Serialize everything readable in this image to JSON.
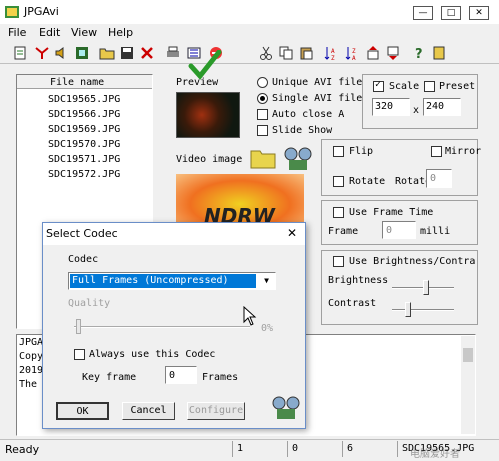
{
  "window": {
    "title": "JPGAvi"
  },
  "menu": [
    "File",
    "Edit",
    "View",
    "Help"
  ],
  "toolbar": {
    "icons": [
      "new-icon",
      "cut-marker-icon",
      "speaker-icon",
      "film-icon",
      "open-folder-icon",
      "save-icon",
      "delete-icon",
      "print-icon",
      "add-frame-icon",
      "no-icon",
      "scissors-icon",
      "copy-icon",
      "paste-icon",
      "sort-asc-icon",
      "sort-desc-icon",
      "move-up-icon",
      "move-down-icon",
      "help-icon",
      "about-icon"
    ]
  },
  "filelist": {
    "header": "File name",
    "files": [
      "SDC19565.JPG",
      "SDC19566.JPG",
      "SDC19569.JPG",
      "SDC19570.JPG",
      "SDC19571.JPG",
      "SDC19572.JPG"
    ]
  },
  "preview": {
    "label": "Preview",
    "video_image_label": "Video image",
    "banner_text": "NDRW"
  },
  "output": {
    "unique_avi": "Unique AVI file",
    "single_avi": "Single AVI file",
    "auto_close": "Auto close A",
    "slide_show": "Slide Show"
  },
  "scale": {
    "label": "Scale",
    "preset": "Preset",
    "width": "320",
    "x": "x",
    "height": "240"
  },
  "flip": {
    "flip": "Flip",
    "mirror": "Mirror",
    "rotate": "Rotate",
    "rotate_label": "Rotate",
    "rotate_value": "0"
  },
  "frametime": {
    "label": "Use Frame Time",
    "frame": "Frame",
    "value": "0",
    "unit": "milli"
  },
  "brightness": {
    "label": "Use Brightness/Contra",
    "brightness": "Brightness",
    "contrast": "Contrast"
  },
  "log": {
    "lines": [
      "JPGA",
      "Copy",
      "2019",
      "The"
    ]
  },
  "dialog": {
    "title": "Select Codec",
    "codec_label": "Codec",
    "codec_value": "Full Frames (Uncompressed)",
    "quality_label": "Quality",
    "quality_value": "0%",
    "always_use": "Always use this Codec",
    "keyframe_label": "Key frame",
    "keyframe_value": "0",
    "keyframe_unit": "Frames",
    "ok": "OK",
    "cancel": "Cancel",
    "configure": "Configure"
  },
  "status": {
    "text": "Ready",
    "c1": "1",
    "c2": "0",
    "c3": "6",
    "file": "SDC19565.JPG"
  },
  "watermark": "电脑爱好者",
  "colors": {
    "selection": "#0078d7",
    "accent_green": "#2a9a2a",
    "folder": "#e8d44d"
  }
}
